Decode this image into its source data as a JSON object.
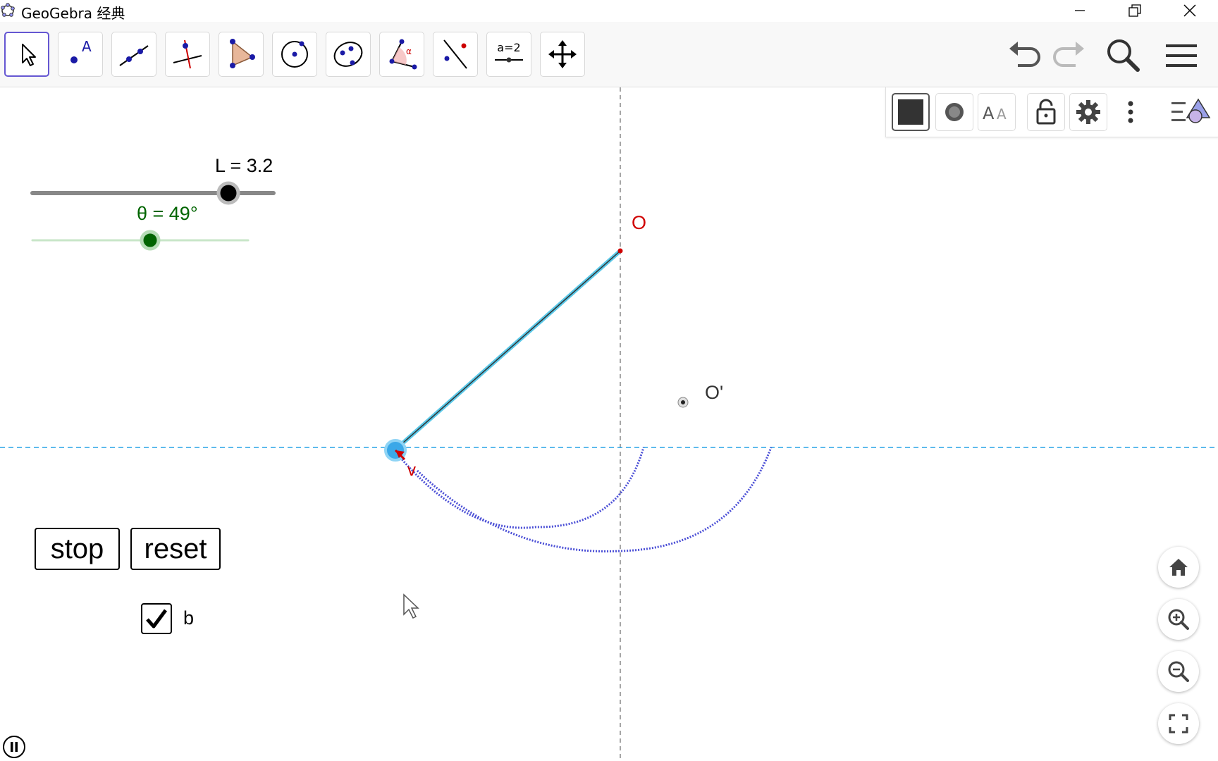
{
  "window": {
    "title": "GeoGebra 经典",
    "minimize_icon": "minimize-icon",
    "restore_icon": "restore-icon",
    "close_icon": "close-icon"
  },
  "toolbar": {
    "tools": [
      {
        "name": "move",
        "icon": "pointer-arrow-icon"
      },
      {
        "name": "point",
        "icon": "point-icon"
      },
      {
        "name": "line",
        "icon": "line-through-points-icon"
      },
      {
        "name": "perpendicular",
        "icon": "perpendicular-line-icon"
      },
      {
        "name": "polygon",
        "icon": "polygon-icon"
      },
      {
        "name": "circle",
        "icon": "circle-center-point-icon"
      },
      {
        "name": "conic",
        "icon": "ellipse-icon"
      },
      {
        "name": "angle",
        "icon": "angle-icon"
      },
      {
        "name": "reflect",
        "icon": "reflect-about-line-icon"
      },
      {
        "name": "slider",
        "icon": "slider-icon",
        "label": "a=2"
      },
      {
        "name": "move-graphics",
        "icon": "move-graphics-view-icon"
      }
    ],
    "undo_icon": "undo-icon",
    "redo_icon": "redo-icon",
    "search_icon": "search-icon",
    "menu_icon": "hamburger-menu-icon"
  },
  "stylebar": {
    "items": [
      "color-swatch-icon",
      "point-style-icon",
      "text-size-icon",
      "lock-icon",
      "gear-icon",
      "more-vertical-icon",
      "graphics-view-toggle-icon"
    ]
  },
  "sliders": {
    "L": {
      "label": "L = 3.2",
      "value": 3.2,
      "fraction": 0.81
    },
    "theta": {
      "label": "θ = 49°",
      "value": 49,
      "fraction": 0.54,
      "color": "#006400"
    }
  },
  "points": {
    "O": {
      "label": "O",
      "color": "#d00000"
    },
    "O_prime": {
      "label": "O'"
    },
    "vector": {
      "label": "v",
      "color": "#d00000"
    }
  },
  "buttons": {
    "stop": "stop",
    "reset": "reset"
  },
  "checkbox": {
    "label": "b",
    "checked": true
  },
  "zoom_controls": [
    "home-icon",
    "zoom-in-icon",
    "zoom-out-icon",
    "fullscreen-icon"
  ],
  "animation": {
    "pause_icon": "pause-icon"
  },
  "colors": {
    "accent": "#6557d2",
    "trace": "#4b4fd6",
    "axis_dash": "#29a3e6",
    "rod": "#5ac8e8"
  }
}
